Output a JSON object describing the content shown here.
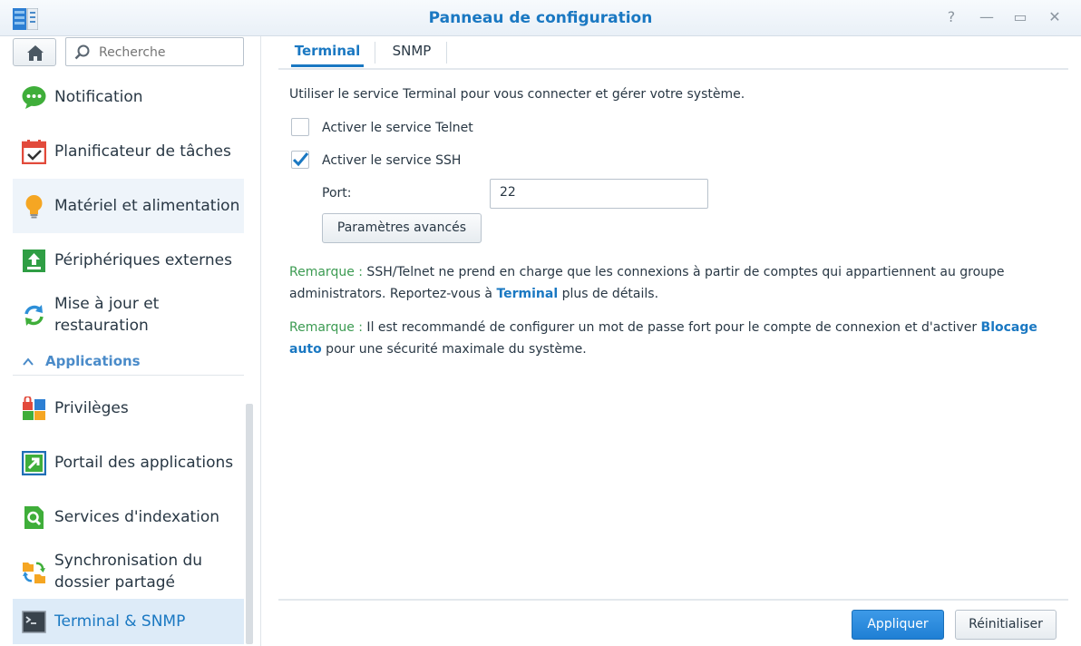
{
  "window": {
    "title": "Panneau de configuration",
    "controls": {
      "help": "?",
      "minimize": "—",
      "maximize": "▭",
      "close": "✕"
    }
  },
  "sidebar": {
    "search_placeholder": "Recherche",
    "items": [
      {
        "label": "Notification",
        "icon": "notification-icon"
      },
      {
        "label": "Planificateur de tâches",
        "icon": "calendar-check-icon"
      },
      {
        "label": "Matériel et alimentation",
        "icon": "lightbulb-icon"
      },
      {
        "label": "Périphériques externes",
        "icon": "upload-icon"
      },
      {
        "label": "Mise à jour et restauration",
        "icon": "refresh-icon"
      }
    ],
    "section_header": "Applications",
    "app_items": [
      {
        "label": "Privilèges",
        "icon": "privileges-icon"
      },
      {
        "label": "Portail des applications",
        "icon": "portal-icon"
      },
      {
        "label": "Services d'indexation",
        "icon": "indexing-icon"
      },
      {
        "label": "Synchronisation du dossier partagé",
        "icon": "sync-folder-icon"
      },
      {
        "label": "Terminal & SNMP",
        "icon": "terminal-icon"
      }
    ]
  },
  "tabs": [
    {
      "label": "Terminal",
      "active": true
    },
    {
      "label": "SNMP",
      "active": false
    }
  ],
  "terminal": {
    "description": "Utiliser le service Terminal pour vous connecter et gérer votre système.",
    "telnet_label": "Activer le service Telnet",
    "telnet_checked": false,
    "ssh_label": "Activer le service SSH",
    "ssh_checked": true,
    "port_label": "Port:",
    "port_value": "22",
    "advanced_button": "Paramètres avancés",
    "note1": {
      "prefix": "Remarque :",
      "text1": " SSH/Telnet ne prend en charge que les connexions à partir de comptes qui appartiennent au groupe administrators. Reportez-vous à ",
      "link": "Terminal",
      "text2": " plus de détails."
    },
    "note2": {
      "prefix": "Remarque :",
      "text1": " Il est recommandé de configurer un mot de passe fort pour le compte de connexion et d'activer ",
      "link": "Blocage auto",
      "text2": " pour une sécurité maximale du système."
    }
  },
  "footer": {
    "apply_button": "Appliquer",
    "reset_button": "Réinitialiser"
  },
  "colors": {
    "accent": "#1a78c2",
    "note_green": "#3c9b52",
    "selected_bg": "#ddebf8"
  }
}
